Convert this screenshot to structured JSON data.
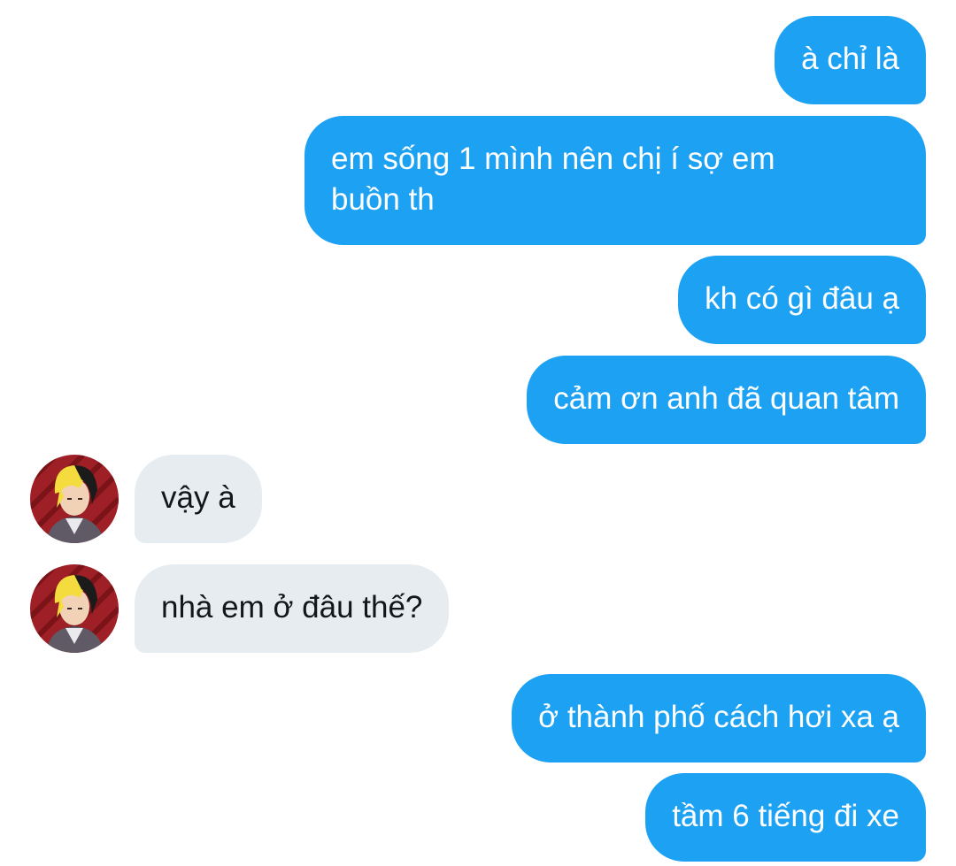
{
  "conversation": {
    "messages": [
      {
        "sender": "me",
        "text": "à chỉ là"
      },
      {
        "sender": "me",
        "text": "em sống 1 mình nên chị í sợ em\nbuồn th"
      },
      {
        "sender": "me",
        "text": "kh có gì đâu ạ"
      },
      {
        "sender": "me",
        "text": "cảm ơn anh đã quan tâm"
      },
      {
        "sender": "them",
        "text": "vậy à",
        "avatar_icon": "anime-avatar-icon"
      },
      {
        "sender": "them",
        "text": "nhà em ở đâu thế?",
        "avatar_icon": "anime-avatar-icon"
      },
      {
        "sender": "me",
        "text": "ở thành phố cách hơi xa ạ"
      },
      {
        "sender": "me",
        "text": "tầm 6 tiếng đi xe"
      }
    ]
  },
  "colors": {
    "outgoing_bubble": "#1da1f2",
    "outgoing_text": "#ffffff",
    "incoming_bubble": "#e6ecf0",
    "incoming_text": "#14171a",
    "background": "#ffffff"
  }
}
